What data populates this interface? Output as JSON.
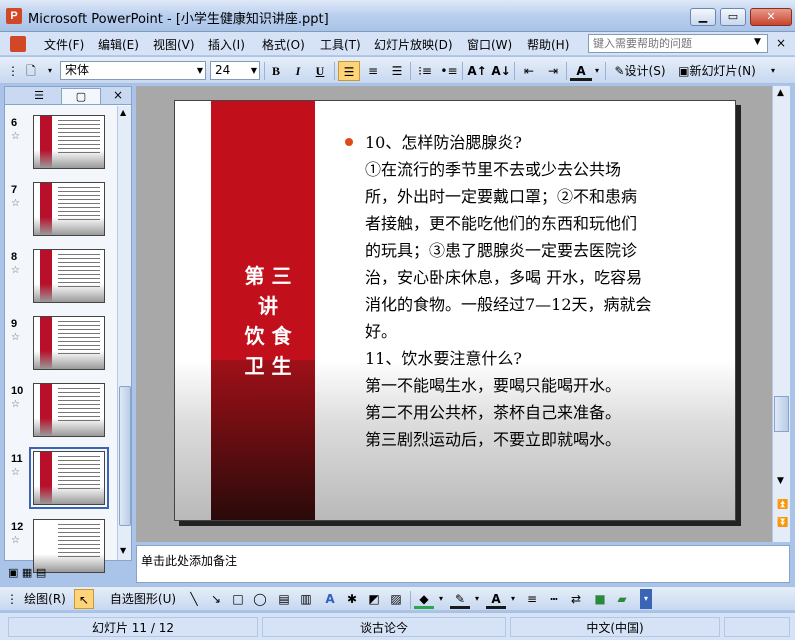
{
  "window": {
    "app_name": "Microsoft PowerPoint",
    "doc_title": "Microsoft PowerPoint - [小学生健康知识讲座.ppt]",
    "minimize": "▁",
    "maximize": "▭",
    "close": "✕"
  },
  "menubar": {
    "items": [
      "文件(F)",
      "编辑(E)",
      "视图(V)",
      "插入(I)",
      "格式(O)",
      "工具(T)",
      "幻灯片放映(D)",
      "窗口(W)",
      "帮助(H)"
    ],
    "help_placeholder": "键入需要帮助的问题",
    "close_label": "×"
  },
  "toolbar": {
    "font_name": "宋体",
    "font_size": "24",
    "bold": "B",
    "italic": "I",
    "underline": "U",
    "design_label": "设计(S)",
    "new_slide_label": "新幻灯片(N)"
  },
  "slides_pane": {
    "tabs": [
      "☰",
      "▢"
    ],
    "close": "×",
    "thumbnails": [
      {
        "number": "6",
        "selected": false
      },
      {
        "number": "7",
        "selected": false
      },
      {
        "number": "8",
        "selected": false
      },
      {
        "number": "9",
        "selected": false
      },
      {
        "number": "10",
        "selected": false
      },
      {
        "number": "11",
        "selected": true
      },
      {
        "number": "12",
        "selected": false
      }
    ]
  },
  "slide": {
    "heading_col1": "第\n讲\n饮\n卫",
    "heading_col2": "三\n\n食\n生",
    "heading_text": [
      "第 三",
      "讲",
      "饮 食",
      "卫 生"
    ],
    "lines": [
      "10、怎样防治腮腺炎?",
      "①在流行的季节里不去或少去公共场",
      "所，外出时一定要戴口罩；②不和患病",
      "者接触，更不能吃他们的东西和玩他们",
      "的玩具；③患了腮腺炎一定要去医院诊",
      "治，安心卧床休息，多喝 开水，吃容易",
      "消化的食物。一般经过7—12天，病就会",
      "好。",
      "11、饮水要注意什么?",
      "第一不能喝生水，要喝只能喝开水。",
      "第二不用公共杯，茶杯自己来准备。",
      "第三剧烈运动后，不要立即就喝水。"
    ]
  },
  "notes": {
    "placeholder": "单击此处添加备注"
  },
  "drawbar": {
    "draw_label": "绘图(R)",
    "autoshapes_label": "自选图形(U)"
  },
  "statusbar": {
    "slide_info": "幻灯片 11 / 12",
    "design_name": "谈古论今",
    "language": "中文(中国)"
  },
  "colors": {
    "slide_accent": "#c1101c",
    "bullet": "#e04a1a",
    "selection": "#3a64b4"
  }
}
